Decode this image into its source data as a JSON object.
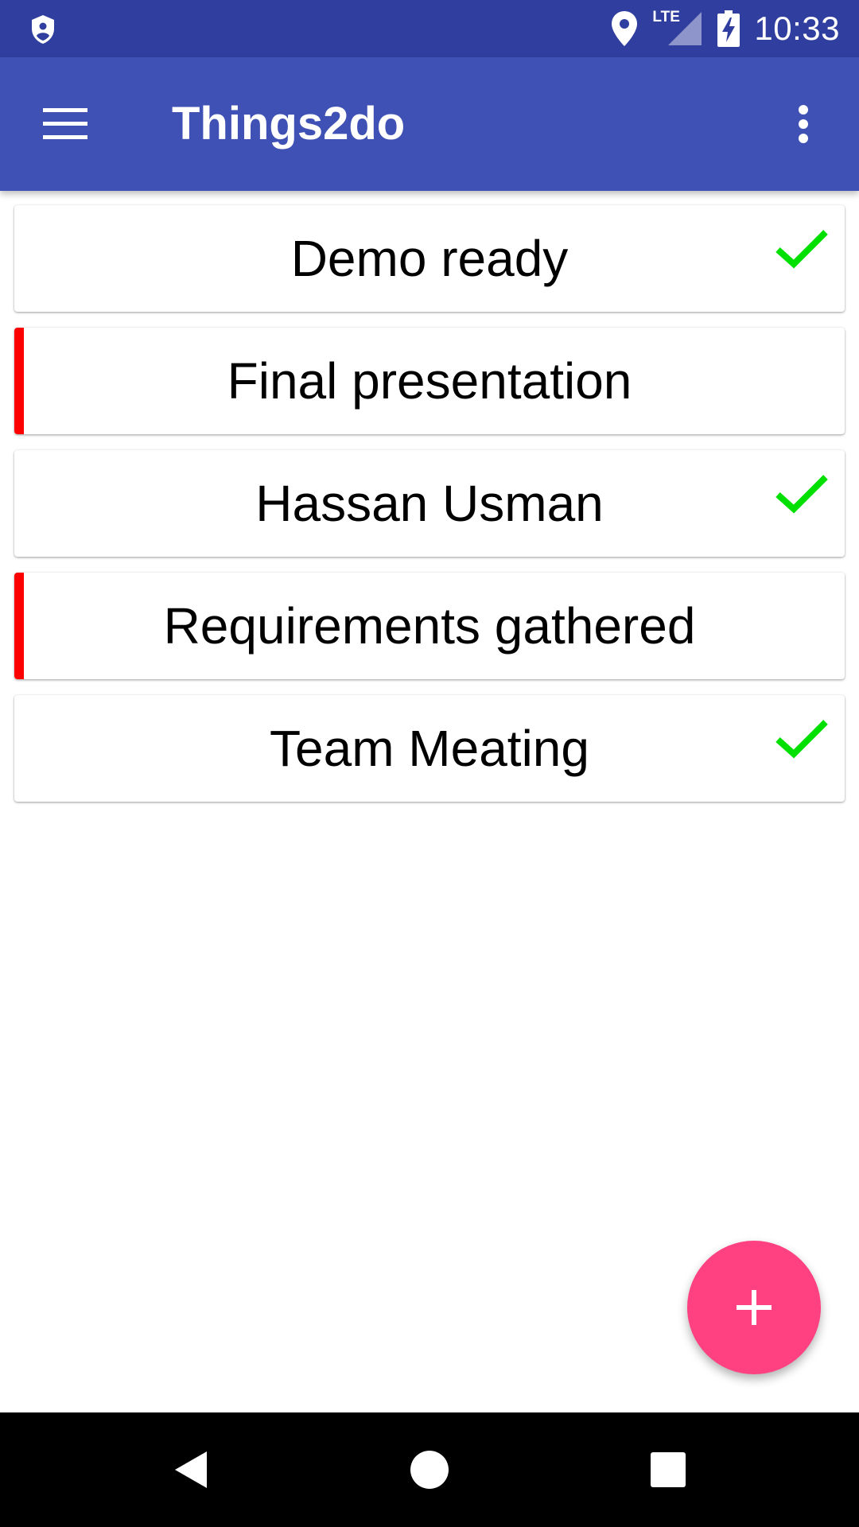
{
  "status_bar": {
    "time": "10:33",
    "network": "LTE",
    "icons": [
      "shield-icon",
      "location-icon",
      "lte-signal-icon",
      "battery-charging-icon"
    ]
  },
  "app_bar": {
    "title": "Things2do",
    "menu_icon": "hamburger-menu-icon",
    "overflow_icon": "more-vert-icon",
    "color": "#3f51b5",
    "status_color": "#303f9f"
  },
  "tasks": [
    {
      "title": "Demo ready",
      "done": true,
      "priority": false
    },
    {
      "title": "Final presentation",
      "done": false,
      "priority": true
    },
    {
      "title": "Hassan Usman",
      "done": true,
      "priority": false
    },
    {
      "title": "Requirements gathered",
      "done": false,
      "priority": true
    },
    {
      "title": "Team Meating",
      "done": true,
      "priority": false
    }
  ],
  "colors": {
    "check": "#00e000",
    "priority": "#ff0000",
    "fab": "#ff4081"
  },
  "fab": {
    "icon": "plus-icon"
  },
  "nav_bar": {
    "icons": [
      "back-icon",
      "home-icon",
      "recents-icon"
    ]
  }
}
